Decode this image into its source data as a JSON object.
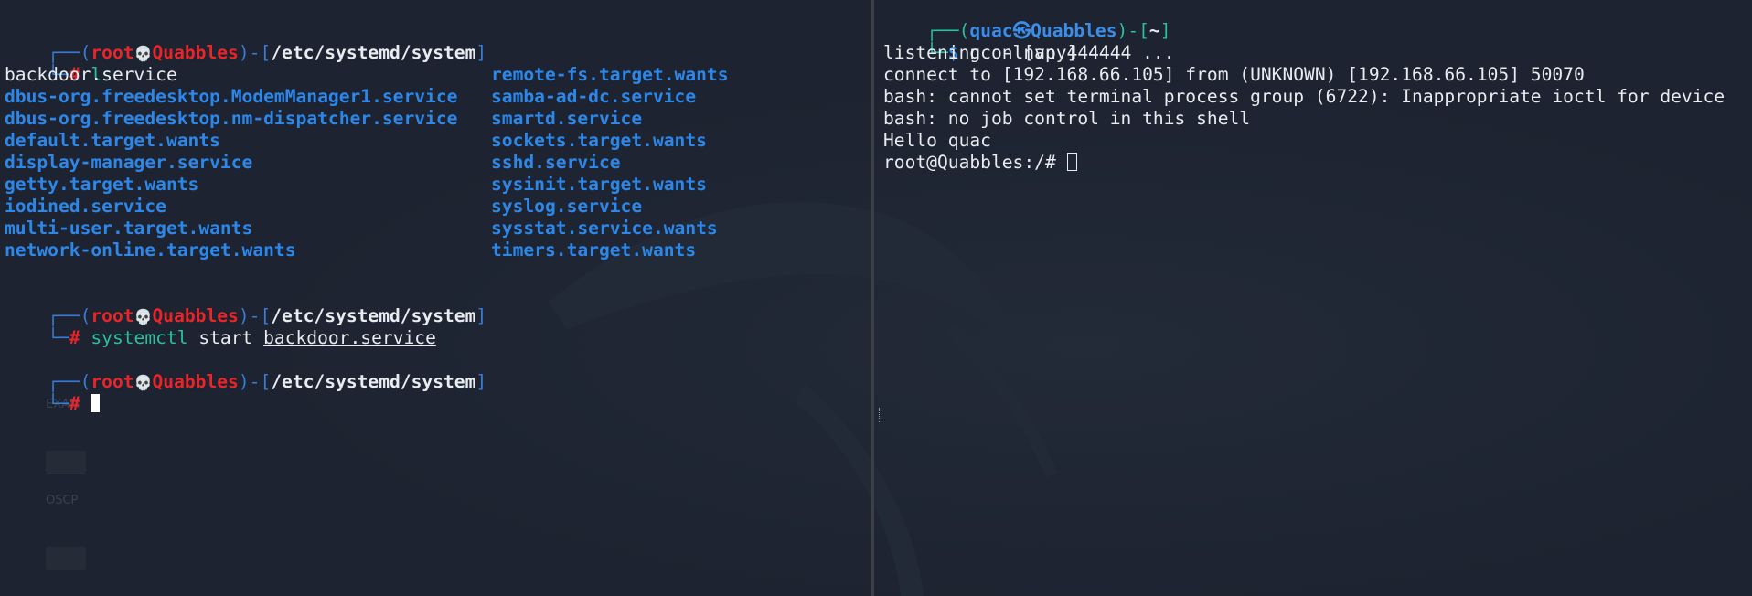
{
  "left": {
    "prompt_user": "root",
    "prompt_host": "Quabbles",
    "skull_glyph": "💀",
    "prompt_path": "/etc/systemd/system",
    "prompt_symbol": "#",
    "cmd1": "ls",
    "ls_col1": [
      "backdoor.service",
      "dbus-org.freedesktop.ModemManager1.service",
      "dbus-org.freedesktop.nm-dispatcher.service",
      "default.target.wants",
      "display-manager.service",
      "getty.target.wants",
      "iodined.service",
      "multi-user.target.wants",
      "network-online.target.wants"
    ],
    "ls_col2": [
      "remote-fs.target.wants",
      "samba-ad-dc.service",
      "smartd.service",
      "sockets.target.wants",
      "sshd.service",
      "sysinit.target.wants",
      "syslog.service",
      "sysstat.service.wants",
      "timers.target.wants"
    ],
    "cmd2_program": "systemctl",
    "cmd2_verb": "start",
    "cmd2_arg": "backdoor.service",
    "ghost_labels": [
      "EXAM",
      "OSCP"
    ]
  },
  "right": {
    "prompt_user": "quac",
    "prompt_host": "Quabbles",
    "prompt_sep_glyph": "㉿",
    "prompt_path": "~",
    "prompt_symbol": "$",
    "cmd": "nc -lnvp 4444",
    "output": [
      "listening on [any] 4444 ...",
      "connect to [192.168.66.105] from (UNKNOWN) [192.168.66.105] 50070",
      "bash: cannot set terminal process group (6722): Inappropriate ioctl for device",
      "bash: no job control in this shell",
      "Hello quac"
    ],
    "shell_prompt": "root@Quabbles:/# "
  },
  "colors": {
    "background": "#1d2330",
    "root_red": "#e8262a",
    "user_blue": "#3a8eea",
    "dir_blue": "#2d87e8",
    "cmd_green": "#2bbf9f",
    "frame_blue": "#3a7bd5"
  }
}
